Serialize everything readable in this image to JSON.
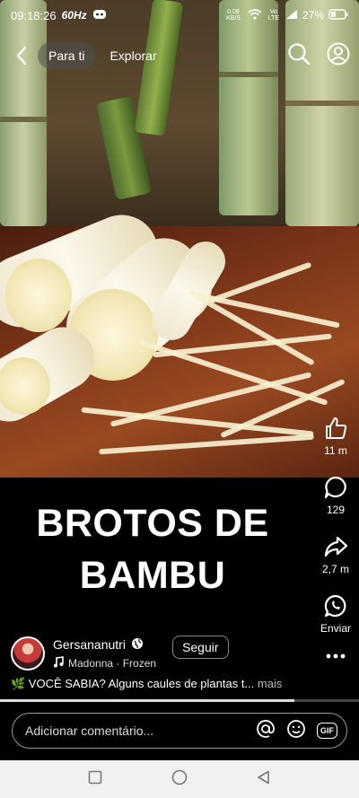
{
  "status_bar": {
    "time": "09:18:26",
    "fps": "60Hz",
    "net_speed": "0,08 KB/S",
    "carrier": "Vo LTE",
    "battery": "27%"
  },
  "top_nav": {
    "tabs": [
      {
        "label": "Para ti",
        "active": true
      },
      {
        "label": "Explorar",
        "active": false
      }
    ]
  },
  "video": {
    "caption_lines": [
      "BROTOS DE",
      "BAMBU"
    ]
  },
  "actions": {
    "likes": "11 m",
    "comments": "129",
    "shares": "2,7 m",
    "whatsapp": "Enviar"
  },
  "author": {
    "name": "Gersananutri",
    "music": "Madonna · Frozen",
    "follow_label": "Seguir"
  },
  "description": {
    "text": "🌿 VOCÊ SABIA? Alguns caules de plantas t...",
    "more_label": "mais"
  },
  "progress": {
    "fraction": 0.82
  },
  "comment": {
    "placeholder": "Adicionar comentário...",
    "gif_label": "GIF"
  },
  "colors": {
    "accent": "#ffffff",
    "nav_bg": "#f1f1f1"
  }
}
